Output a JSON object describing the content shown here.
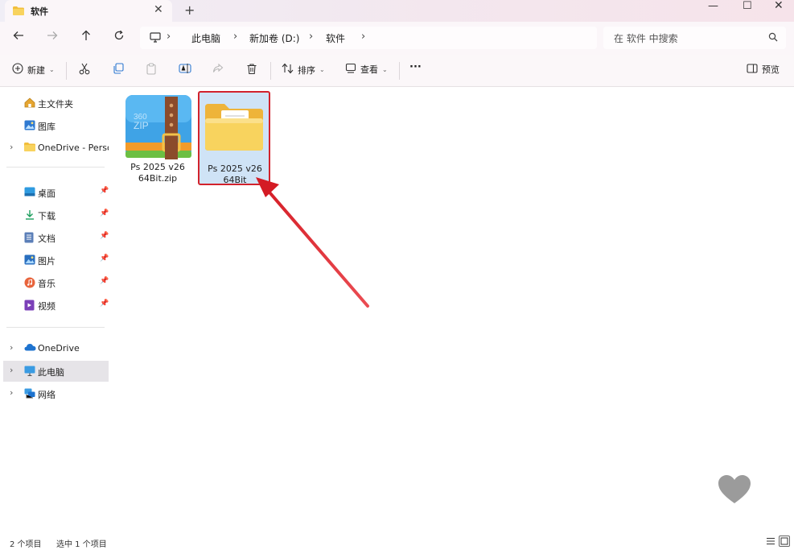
{
  "window": {
    "tab_title": "软件",
    "new_tab": "+",
    "close_tab": "✕",
    "minimize": "—",
    "maximize": "☐",
    "close": "✕"
  },
  "nav": {
    "breadcrumbs": [
      "此电脑",
      "新加卷 (D:)",
      "软件"
    ],
    "search_placeholder": "在 软件 中搜索"
  },
  "toolbar": {
    "new_label": "新建",
    "sort_label": "排序",
    "view_label": "查看",
    "more_label": "···",
    "preview_label": "预览"
  },
  "sidebar": {
    "items": [
      {
        "label": "主文件夹",
        "icon": "home-icon"
      },
      {
        "label": "图库",
        "icon": "gallery-icon"
      },
      {
        "label": "OneDrive - Personal",
        "icon": "folder-icon"
      },
      {
        "label": "桌面",
        "icon": "desktop-icon"
      },
      {
        "label": "下载",
        "icon": "download-icon"
      },
      {
        "label": "文档",
        "icon": "document-icon"
      },
      {
        "label": "图片",
        "icon": "pictures-icon"
      },
      {
        "label": "音乐",
        "icon": "music-icon"
      },
      {
        "label": "视频",
        "icon": "video-icon"
      },
      {
        "label": "OneDrive",
        "icon": "cloud-icon"
      },
      {
        "label": "此电脑",
        "icon": "computer-icon"
      },
      {
        "label": "网络",
        "icon": "network-icon"
      }
    ]
  },
  "files": [
    {
      "name_line1": "Ps 2025 v26",
      "name_line2": "64Bit.zip",
      "type": "zip-archive"
    },
    {
      "name_line1": "Ps 2025 v26",
      "name_line2": "64Bit",
      "type": "folder"
    }
  ],
  "status": {
    "item_count": "2 个项目",
    "selected": "选中 1 个项目"
  },
  "colors": {
    "accent_red": "#d2222c",
    "selection_blue": "#cfe3f6",
    "folder_yellow": "#f6c64a"
  }
}
